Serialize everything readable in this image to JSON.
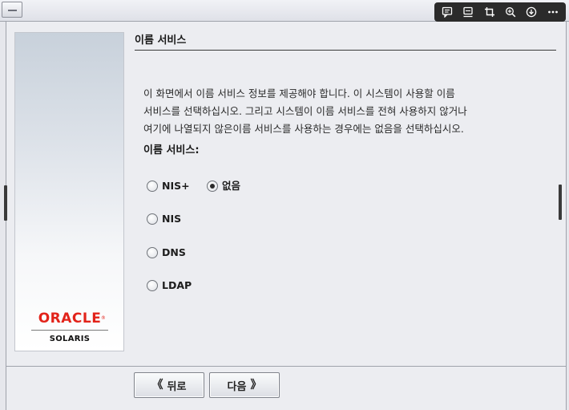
{
  "page": {
    "title": "이름 서비스",
    "description_lines": [
      "이 화면에서 이름 서비스 정보를 제공해야 합니다. 이 시스템이 사용할 이름",
      "서비스를 선택하십시오. 그리고 시스템이 이름 서비스를 전혀 사용하지 않거나",
      "여기에 나열되지 않은이름 서비스를 사용하는 경우에는 없음을 선택하십시오."
    ],
    "section_label": "이름 서비스:"
  },
  "name_service": {
    "selected": "없음",
    "options": {
      "nisplus": "NIS+",
      "none": "없음",
      "nis": "NIS",
      "dns": "DNS",
      "ldap": "LDAP"
    }
  },
  "branding": {
    "oracle": "ORACLE",
    "registered": "®",
    "product": "SOLARIS",
    "oracle_color": "#e2231a"
  },
  "navigation": {
    "back_label": "뒤로",
    "back_arrow": "《",
    "next_label": "다음",
    "next_arrow": "》"
  },
  "viewer_toolbar": {
    "icons": [
      "comment-icon",
      "display-icon",
      "crop-icon",
      "zoom-in-icon",
      "download-icon",
      "more-icon"
    ]
  }
}
